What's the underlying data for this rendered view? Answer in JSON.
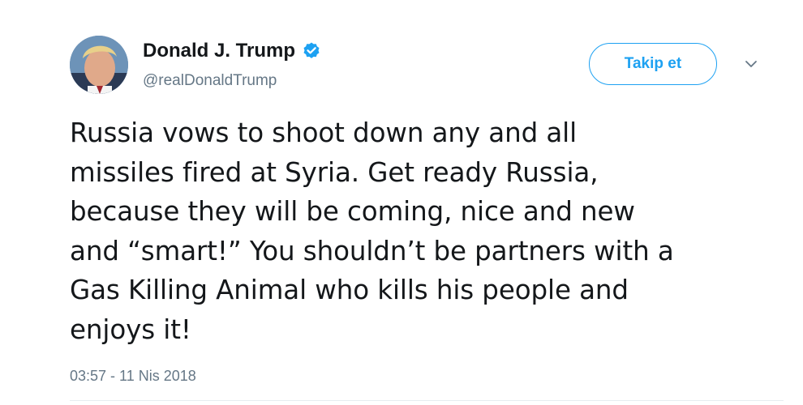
{
  "tweet": {
    "author": {
      "display_name": "Donald J. Trump",
      "handle": "@realDonaldTrump",
      "verified": true,
      "avatar_icon": "avatar-photo"
    },
    "follow_label": "Takip et",
    "caret_icon": "chevron-down-icon",
    "text_lines": [
      "Russia vows to shoot down any and all",
      "missiles fired at Syria. Get ready Russia,",
      "because they will be coming, nice and new",
      "and “smart!” You shouldn’t be partners with a",
      "Gas Killing Animal who kills his people and",
      "enjoys it!"
    ],
    "timestamp": "03:57 - 11 Nis 2018"
  },
  "colors": {
    "accent": "#1da1f2",
    "text_primary": "#14171a",
    "text_secondary": "#657786",
    "divider": "#e6ecf0"
  }
}
